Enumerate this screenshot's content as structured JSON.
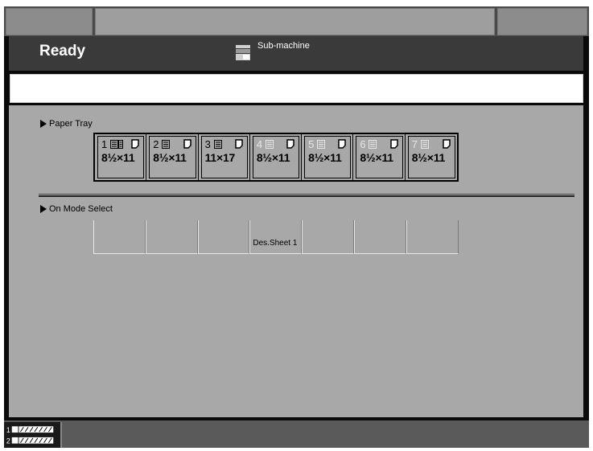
{
  "header": {
    "status": "Ready",
    "submachine_label": "Sub-machine"
  },
  "sections": {
    "paper_tray_title": "Paper Tray",
    "mode_select_title": "On Mode Select"
  },
  "trays": [
    {
      "number": "1",
      "size": "8½×11",
      "active": true
    },
    {
      "number": "2",
      "size": "8½×11",
      "active": true
    },
    {
      "number": "3",
      "size": "11×17",
      "active": true
    },
    {
      "number": "4",
      "size": "8½×11",
      "active": false
    },
    {
      "number": "5",
      "size": "8½×11",
      "active": false
    },
    {
      "number": "6",
      "size": "8½×11",
      "active": false
    },
    {
      "number": "7",
      "size": "8½×11",
      "active": false
    }
  ],
  "modes": [
    {
      "label": ""
    },
    {
      "label": ""
    },
    {
      "label": ""
    },
    {
      "label": "Des.Sheet 1"
    },
    {
      "label": ""
    },
    {
      "label": ""
    },
    {
      "label": ""
    }
  ],
  "colors": {
    "panel": "#a8a8a8",
    "header": "#3a3a3a",
    "topbar": "#9e9e9e"
  },
  "icons": {
    "submachine": "submachine-icon",
    "tray_stack": "paper-stack-icon",
    "tray_doc": "document-icon",
    "status_tray": "tray-status-icon"
  }
}
